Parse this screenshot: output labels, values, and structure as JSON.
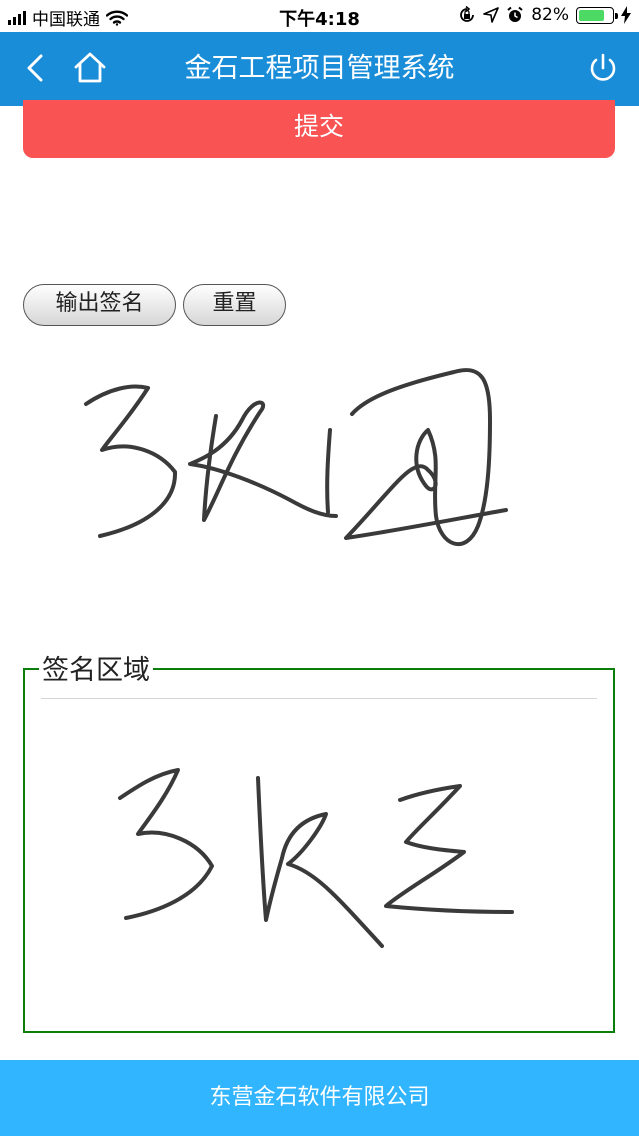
{
  "status_bar": {
    "carrier": "中国联通",
    "time": "下午4:18",
    "battery_percent": "82%",
    "battery_level": 0.82,
    "icons": [
      "signal-icon",
      "wifi-icon",
      "orientation-lock-icon",
      "location-icon",
      "alarm-icon",
      "battery-icon",
      "charging-icon"
    ]
  },
  "header": {
    "title": "金石工程项目管理系统",
    "icons": [
      "back-icon",
      "home-icon",
      "power-icon"
    ]
  },
  "submit_label": "提交",
  "actions": {
    "export_label": "输出签名",
    "reset_label": "重置"
  },
  "signature_area": {
    "legend": "签名区域"
  },
  "footer": {
    "company": "东营金石软件有限公司"
  },
  "colors": {
    "header": "#1a8dd8",
    "submit": "#fa5354",
    "fieldset_border": "#0a7d0a",
    "footer": "#32b5ff",
    "ink": "#333333"
  }
}
